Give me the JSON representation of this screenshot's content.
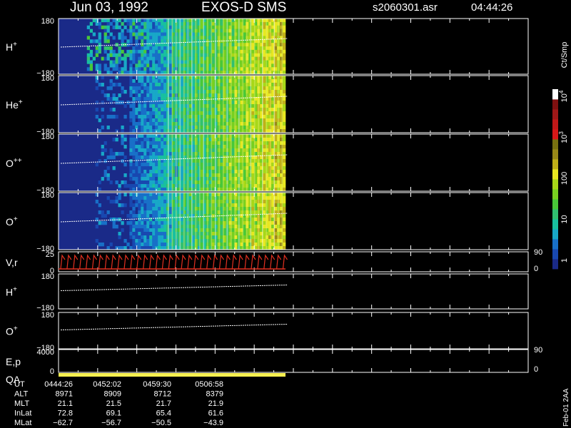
{
  "header": {
    "date": "Jun 03, 1992",
    "mission": "EXOS-D SMS",
    "file": "s2060301.asr",
    "time": "04:44:26"
  },
  "colors": {
    "background": "#000000",
    "axes": "#ffffff",
    "trace": "#ffffff",
    "vr_trace": "#e03020",
    "qa_bar": "#f5f050",
    "colorbar": [
      "#1a2a88",
      "#1848b0",
      "#1870c8",
      "#18a8c8",
      "#18c0a0",
      "#30c070",
      "#48c838",
      "#78d020",
      "#a8d818",
      "#e8e820",
      "#c0b018",
      "#988818",
      "#787010",
      "#d81818",
      "#c01818",
      "#a01818",
      "#801010",
      "#ffffff"
    ]
  },
  "chart_data": {
    "type": "heatmap",
    "panels": [
      {
        "label": "H",
        "sup": "+",
        "ymax": "180",
        "ymin": "−180",
        "kind": "spectrogram"
      },
      {
        "label": "He",
        "sup": "+",
        "ymax": "180",
        "ymin": "−180",
        "kind": "spectrogram"
      },
      {
        "label": "O",
        "sup": "++",
        "ymax": "180",
        "ymin": "−180",
        "kind": "spectrogram"
      },
      {
        "label": "O",
        "sup": "+",
        "ymax": "180",
        "ymin": "−180",
        "kind": "spectrogram"
      },
      {
        "label": "V,r",
        "sup": "",
        "ymax": "25",
        "ymin": "0",
        "right_top": "90",
        "right_bottom": "0",
        "kind": "vr"
      },
      {
        "label": "H",
        "sup": "+",
        "ymax": "180",
        "ymin": "−180",
        "kind": "line"
      },
      {
        "label": "O",
        "sup": "+",
        "ymax": "180",
        "ymin": "−180",
        "kind": "line"
      },
      {
        "label": "E,p",
        "sup": "",
        "ymax": "4000",
        "ymin": "0",
        "right_top": "90",
        "right_bottom": "0",
        "kind": "ep"
      }
    ],
    "colorbar": {
      "unit": "Ct/Smp",
      "ticks": [
        {
          "value": 1,
          "label": "1"
        },
        {
          "value": 10,
          "label": "10"
        },
        {
          "value": 100,
          "label": "100"
        },
        {
          "value": 1000,
          "label": "10",
          "exp": "3"
        },
        {
          "value": 10000,
          "label": "10",
          "exp": "4"
        }
      ]
    },
    "qa_label": "QA",
    "table": {
      "rows": [
        {
          "name": "UT",
          "values": [
            "0444:26",
            "0452:02",
            "0459:30",
            "0506:58"
          ]
        },
        {
          "name": "ALT",
          "values": [
            "8971",
            "8909",
            "8712",
            "8379"
          ]
        },
        {
          "name": "MLT",
          "values": [
            "21.1",
            "21.5",
            "21.7",
            "21.9"
          ]
        },
        {
          "name": "InLat",
          "values": [
            "72.8",
            "69.1",
            "65.4",
            "61.6"
          ]
        },
        {
          "name": "MLat",
          "values": [
            "−62.7",
            "−56.7",
            "−50.5",
            "−43.9"
          ]
        }
      ]
    },
    "footer_note": "Feb-01 2AA"
  }
}
